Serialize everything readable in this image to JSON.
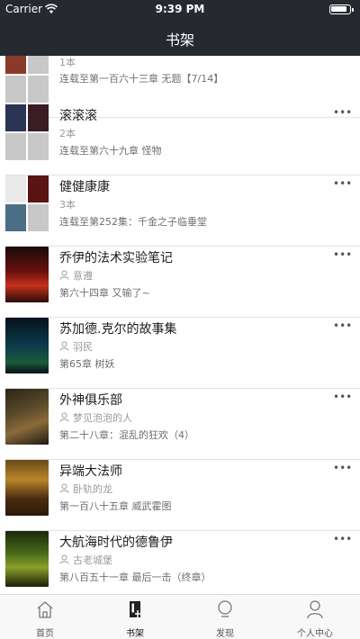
{
  "status_bar": {
    "carrier": "Carrier",
    "time": "9:39 PM"
  },
  "nav": {
    "title": "书架"
  },
  "books": [
    {
      "kind": "group",
      "title": "",
      "sub": "1本",
      "latest": "连载至第一百六十三章 无题【7/14】"
    },
    {
      "kind": "group",
      "title": "滚滚滚",
      "sub": "2本",
      "latest": "连载至第六十九章 怪物"
    },
    {
      "kind": "group",
      "title": "健健康康",
      "sub": "3本",
      "latest": "连载至第252集：千金之子临垂堂"
    },
    {
      "kind": "book",
      "title": "乔伊的法术实验笔记",
      "author": "意遵",
      "latest": "第六十四章 又输了~"
    },
    {
      "kind": "book",
      "title": "苏加德.克尔的故事集",
      "author": "羽民",
      "latest": "第65章 树妖"
    },
    {
      "kind": "book",
      "title": "外神俱乐部",
      "author": "梦见泡泡的人",
      "latest": "第二十八章：混乱的狂欢（4）"
    },
    {
      "kind": "book",
      "title": "异端大法师",
      "author": "卧轨的龙",
      "latest": "第一百八十五章 威武霍图"
    },
    {
      "kind": "book",
      "title": "大航海时代的德鲁伊",
      "author": "古老城堡",
      "latest": "第八百五十一章 最后一击（终章）"
    }
  ],
  "more_label": "•••",
  "tabs": [
    {
      "label": "首页",
      "icon": "home-icon"
    },
    {
      "label": "书架",
      "icon": "bookshelf-icon"
    },
    {
      "label": "发现",
      "icon": "discover-icon"
    },
    {
      "label": "个人中心",
      "icon": "profile-icon"
    }
  ],
  "colors": {
    "bar": "#262a30",
    "accent": "#1b1b1b",
    "muted": "#9a9a9a"
  }
}
